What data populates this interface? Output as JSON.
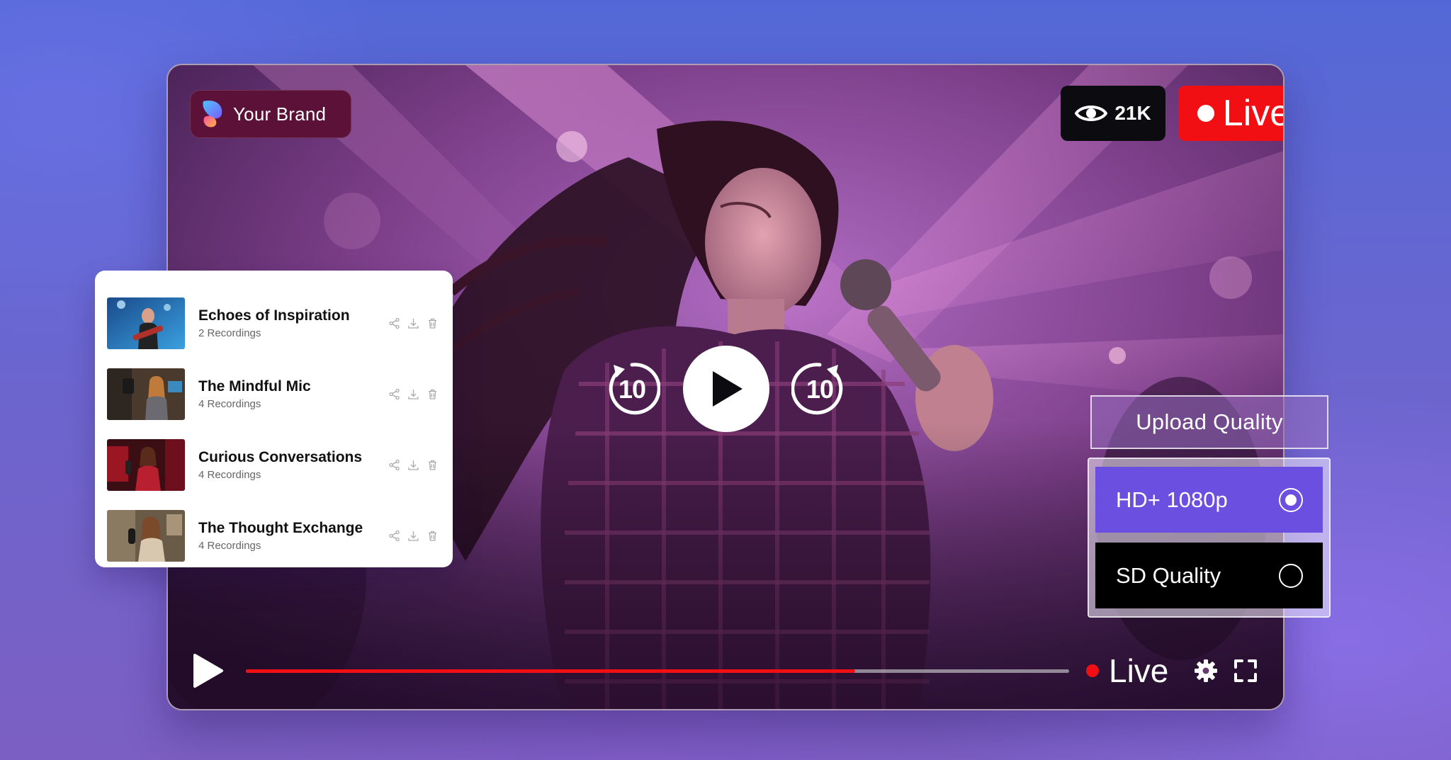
{
  "brand": {
    "name": "Your Brand",
    "logo_icon": "butterfly-logo-icon"
  },
  "stats": {
    "views": "21K",
    "views_icon": "eye-icon"
  },
  "live_badge": {
    "label": "Live",
    "color": "#f20f14"
  },
  "player": {
    "skip_back_label": "10",
    "skip_forward_label": "10",
    "progress": 0.74,
    "live_label": "Live",
    "icons": [
      "play-icon",
      "rewind-10-icon",
      "forward-10-icon",
      "gear-icon",
      "fullscreen-icon"
    ]
  },
  "playlist": {
    "items": [
      {
        "title": "Echoes of Inspiration",
        "subtitle": "2 Recordings"
      },
      {
        "title": "The Mindful Mic",
        "subtitle": "4 Recordings"
      },
      {
        "title": "Curious Conversations",
        "subtitle": "4 Recordings"
      },
      {
        "title": "The Thought Exchange",
        "subtitle": "4 Recordings"
      }
    ],
    "action_icons": [
      "share-icon",
      "download-icon",
      "trash-icon"
    ]
  },
  "quality": {
    "header": "Upload Quality",
    "options": [
      {
        "label": "HD+ 1080p",
        "selected": true
      },
      {
        "label": "SD Quality",
        "selected": false
      }
    ],
    "accent": "#6a4fe0"
  }
}
